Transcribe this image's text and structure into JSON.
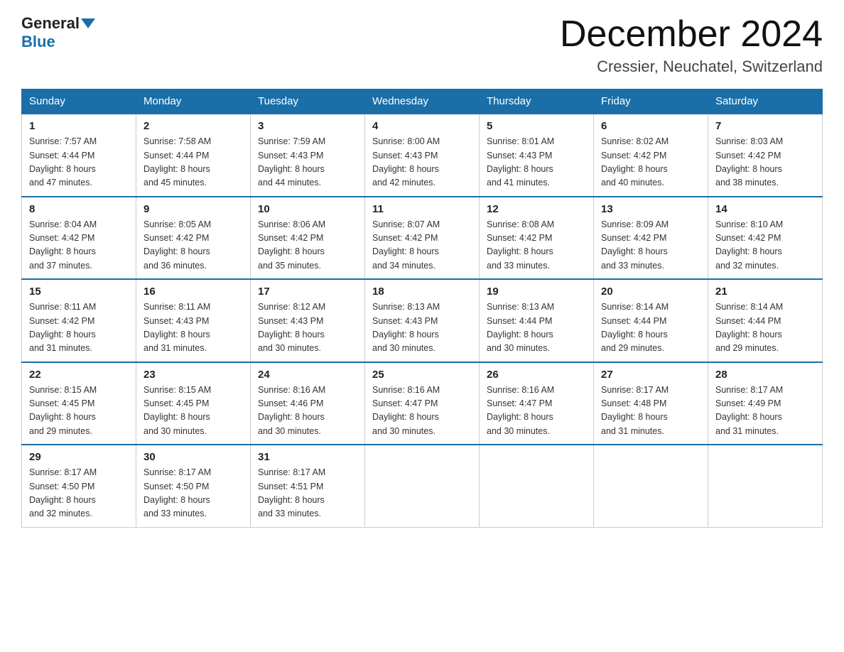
{
  "header": {
    "logo_general": "General",
    "logo_blue": "Blue",
    "month_title": "December 2024",
    "location": "Cressier, Neuchatel, Switzerland"
  },
  "weekdays": [
    "Sunday",
    "Monday",
    "Tuesday",
    "Wednesday",
    "Thursday",
    "Friday",
    "Saturday"
  ],
  "weeks": [
    [
      {
        "day": "1",
        "sunrise": "7:57 AM",
        "sunset": "4:44 PM",
        "daylight": "8 hours and 47 minutes."
      },
      {
        "day": "2",
        "sunrise": "7:58 AM",
        "sunset": "4:44 PM",
        "daylight": "8 hours and 45 minutes."
      },
      {
        "day": "3",
        "sunrise": "7:59 AM",
        "sunset": "4:43 PM",
        "daylight": "8 hours and 44 minutes."
      },
      {
        "day": "4",
        "sunrise": "8:00 AM",
        "sunset": "4:43 PM",
        "daylight": "8 hours and 42 minutes."
      },
      {
        "day": "5",
        "sunrise": "8:01 AM",
        "sunset": "4:43 PM",
        "daylight": "8 hours and 41 minutes."
      },
      {
        "day": "6",
        "sunrise": "8:02 AM",
        "sunset": "4:42 PM",
        "daylight": "8 hours and 40 minutes."
      },
      {
        "day": "7",
        "sunrise": "8:03 AM",
        "sunset": "4:42 PM",
        "daylight": "8 hours and 38 minutes."
      }
    ],
    [
      {
        "day": "8",
        "sunrise": "8:04 AM",
        "sunset": "4:42 PM",
        "daylight": "8 hours and 37 minutes."
      },
      {
        "day": "9",
        "sunrise": "8:05 AM",
        "sunset": "4:42 PM",
        "daylight": "8 hours and 36 minutes."
      },
      {
        "day": "10",
        "sunrise": "8:06 AM",
        "sunset": "4:42 PM",
        "daylight": "8 hours and 35 minutes."
      },
      {
        "day": "11",
        "sunrise": "8:07 AM",
        "sunset": "4:42 PM",
        "daylight": "8 hours and 34 minutes."
      },
      {
        "day": "12",
        "sunrise": "8:08 AM",
        "sunset": "4:42 PM",
        "daylight": "8 hours and 33 minutes."
      },
      {
        "day": "13",
        "sunrise": "8:09 AM",
        "sunset": "4:42 PM",
        "daylight": "8 hours and 33 minutes."
      },
      {
        "day": "14",
        "sunrise": "8:10 AM",
        "sunset": "4:42 PM",
        "daylight": "8 hours and 32 minutes."
      }
    ],
    [
      {
        "day": "15",
        "sunrise": "8:11 AM",
        "sunset": "4:42 PM",
        "daylight": "8 hours and 31 minutes."
      },
      {
        "day": "16",
        "sunrise": "8:11 AM",
        "sunset": "4:43 PM",
        "daylight": "8 hours and 31 minutes."
      },
      {
        "day": "17",
        "sunrise": "8:12 AM",
        "sunset": "4:43 PM",
        "daylight": "8 hours and 30 minutes."
      },
      {
        "day": "18",
        "sunrise": "8:13 AM",
        "sunset": "4:43 PM",
        "daylight": "8 hours and 30 minutes."
      },
      {
        "day": "19",
        "sunrise": "8:13 AM",
        "sunset": "4:44 PM",
        "daylight": "8 hours and 30 minutes."
      },
      {
        "day": "20",
        "sunrise": "8:14 AM",
        "sunset": "4:44 PM",
        "daylight": "8 hours and 29 minutes."
      },
      {
        "day": "21",
        "sunrise": "8:14 AM",
        "sunset": "4:44 PM",
        "daylight": "8 hours and 29 minutes."
      }
    ],
    [
      {
        "day": "22",
        "sunrise": "8:15 AM",
        "sunset": "4:45 PM",
        "daylight": "8 hours and 29 minutes."
      },
      {
        "day": "23",
        "sunrise": "8:15 AM",
        "sunset": "4:45 PM",
        "daylight": "8 hours and 30 minutes."
      },
      {
        "day": "24",
        "sunrise": "8:16 AM",
        "sunset": "4:46 PM",
        "daylight": "8 hours and 30 minutes."
      },
      {
        "day": "25",
        "sunrise": "8:16 AM",
        "sunset": "4:47 PM",
        "daylight": "8 hours and 30 minutes."
      },
      {
        "day": "26",
        "sunrise": "8:16 AM",
        "sunset": "4:47 PM",
        "daylight": "8 hours and 30 minutes."
      },
      {
        "day": "27",
        "sunrise": "8:17 AM",
        "sunset": "4:48 PM",
        "daylight": "8 hours and 31 minutes."
      },
      {
        "day": "28",
        "sunrise": "8:17 AM",
        "sunset": "4:49 PM",
        "daylight": "8 hours and 31 minutes."
      }
    ],
    [
      {
        "day": "29",
        "sunrise": "8:17 AM",
        "sunset": "4:50 PM",
        "daylight": "8 hours and 32 minutes."
      },
      {
        "day": "30",
        "sunrise": "8:17 AM",
        "sunset": "4:50 PM",
        "daylight": "8 hours and 33 minutes."
      },
      {
        "day": "31",
        "sunrise": "8:17 AM",
        "sunset": "4:51 PM",
        "daylight": "8 hours and 33 minutes."
      },
      null,
      null,
      null,
      null
    ]
  ],
  "labels": {
    "sunrise": "Sunrise:",
    "sunset": "Sunset:",
    "daylight": "Daylight:"
  }
}
